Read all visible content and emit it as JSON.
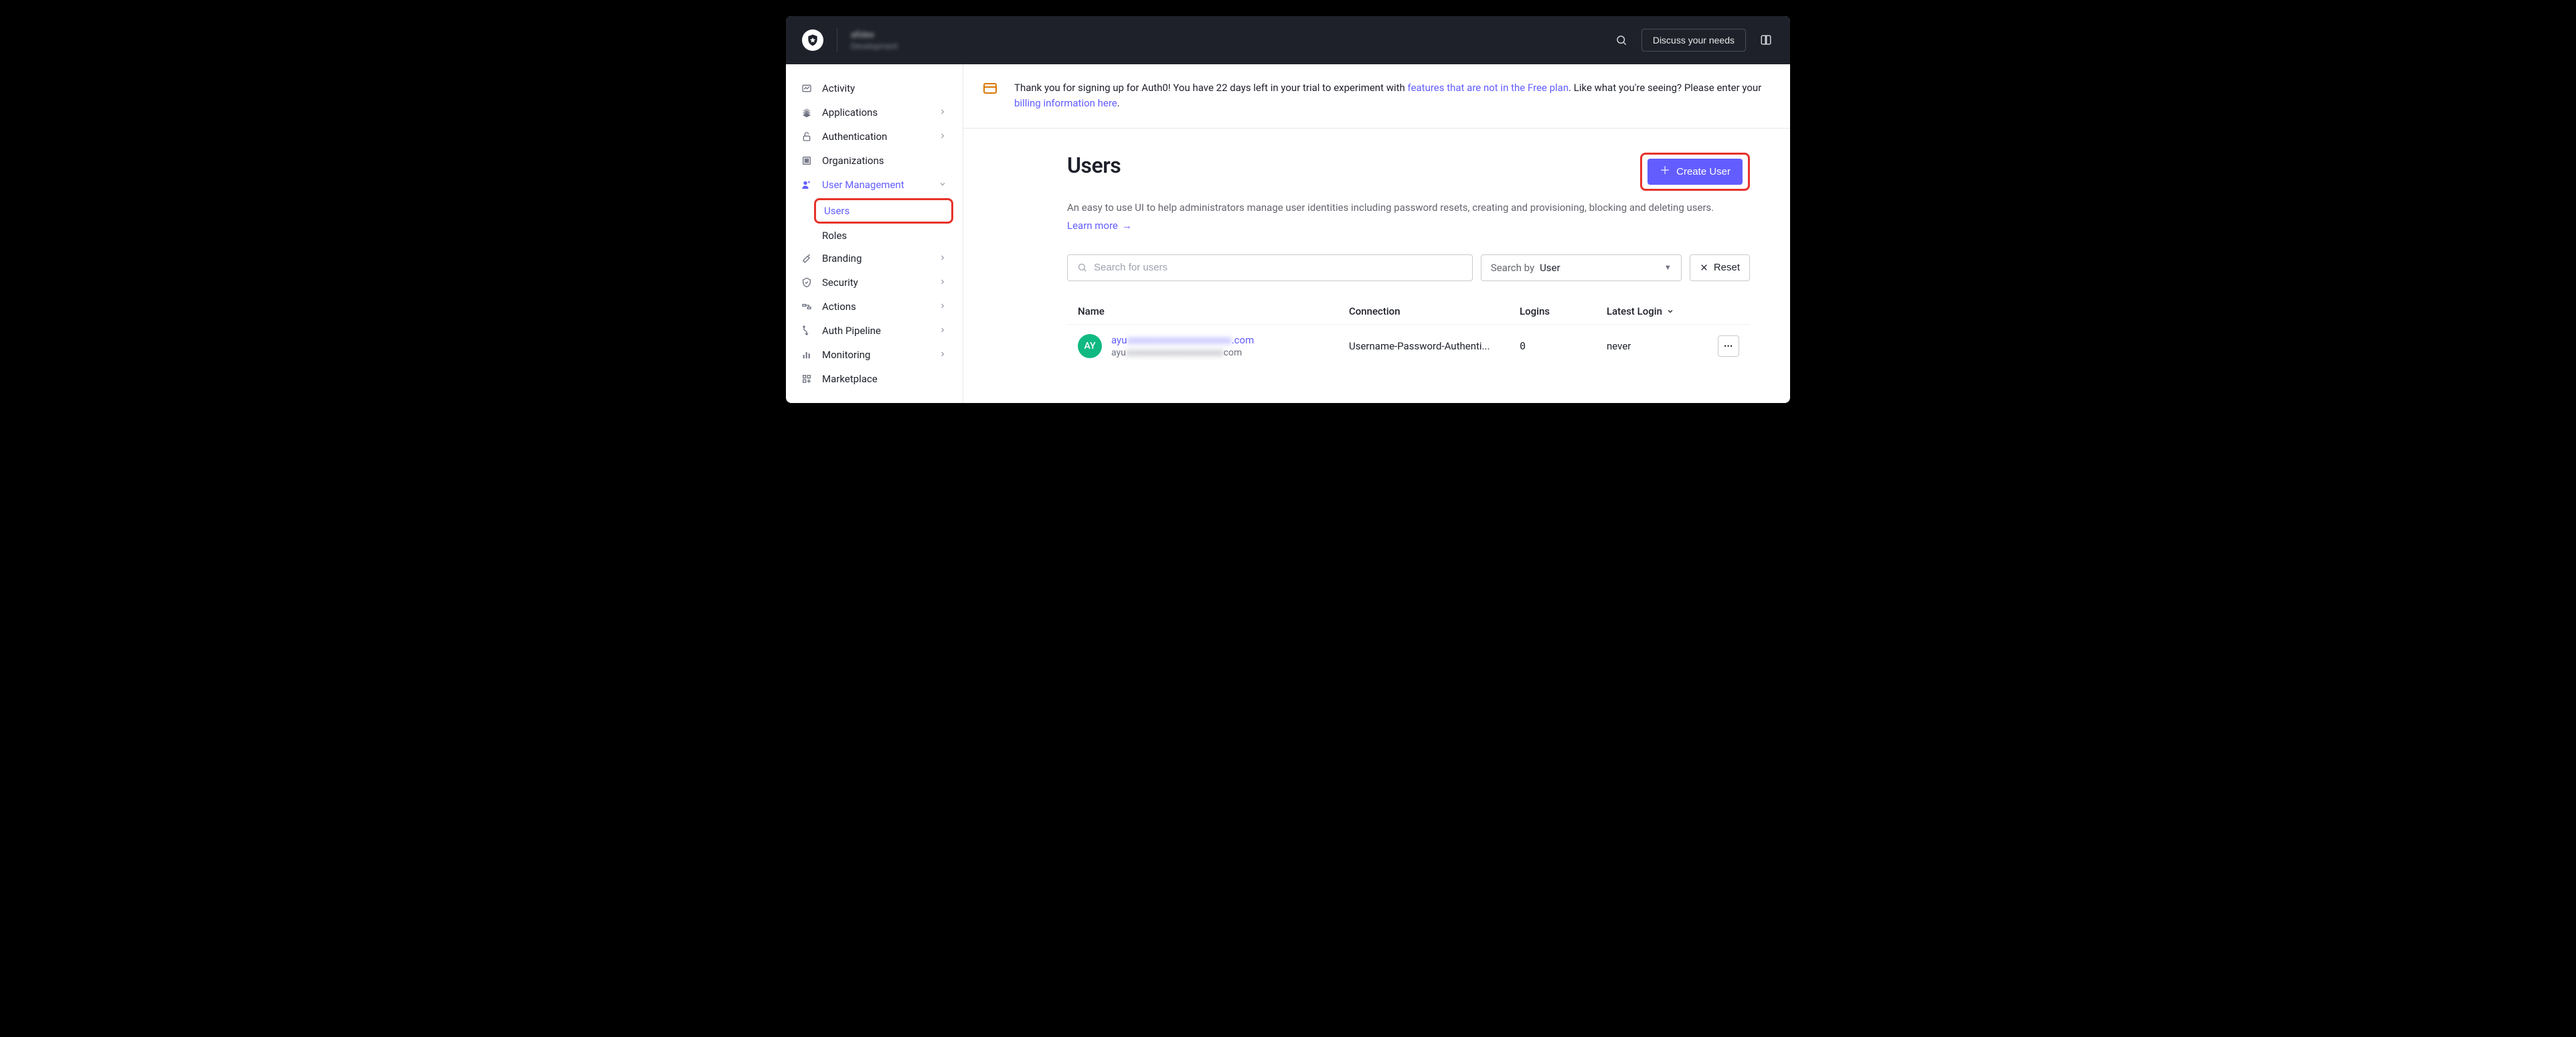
{
  "topbar": {
    "tenant_name": "afidex",
    "tenant_sub": "Development",
    "discuss_label": "Discuss your needs"
  },
  "sidebar": {
    "items": [
      {
        "label": "Activity",
        "icon": "activity-icon",
        "expandable": false
      },
      {
        "label": "Applications",
        "icon": "applications-icon",
        "expandable": true
      },
      {
        "label": "Authentication",
        "icon": "authentication-icon",
        "expandable": true
      },
      {
        "label": "Organizations",
        "icon": "organizations-icon",
        "expandable": false
      },
      {
        "label": "User Management",
        "icon": "user-management-icon",
        "expandable": true,
        "active": true,
        "children": [
          {
            "label": "Users",
            "active": true
          },
          {
            "label": "Roles",
            "active": false
          }
        ]
      },
      {
        "label": "Branding",
        "icon": "branding-icon",
        "expandable": true
      },
      {
        "label": "Security",
        "icon": "security-icon",
        "expandable": true
      },
      {
        "label": "Actions",
        "icon": "actions-icon",
        "expandable": true
      },
      {
        "label": "Auth Pipeline",
        "icon": "auth-pipeline-icon",
        "expandable": true
      },
      {
        "label": "Monitoring",
        "icon": "monitoring-icon",
        "expandable": true
      },
      {
        "label": "Marketplace",
        "icon": "marketplace-icon",
        "expandable": false
      }
    ]
  },
  "banner": {
    "text_pre": "Thank you for signing up for Auth0! You have 22 days left in your trial to experiment with ",
    "link1": "features that are not in the Free plan",
    "text_mid": ". Like what you're seeing? Please enter your ",
    "link2": "billing information here",
    "text_post": "."
  },
  "page": {
    "title": "Users",
    "description": "An easy to use UI to help administrators manage user identities including password resets, creating and provisioning, blocking and deleting users.",
    "learn_more": "Learn more",
    "create_button": "Create User"
  },
  "search": {
    "placeholder": "Search for users",
    "search_by_label": "Search by",
    "search_by_value": "User",
    "reset_label": "Reset"
  },
  "table": {
    "columns": {
      "name": "Name",
      "connection": "Connection",
      "logins": "Logins",
      "latest_login": "Latest Login"
    },
    "rows": [
      {
        "avatar_initials": "AY",
        "avatar_color": "#10b981",
        "email_prefix": "ayu",
        "email_blurred": "xxxxxxxxxxxxxxxxxxxxx",
        "email_suffix": ".com",
        "sub_prefix": "ayu",
        "sub_blurred": "xxxxxxxxxxxxxxxxxxxxx",
        "sub_suffix": "com",
        "connection": "Username-Password-Authenti...",
        "logins": "0",
        "latest_login": "never"
      }
    ]
  }
}
